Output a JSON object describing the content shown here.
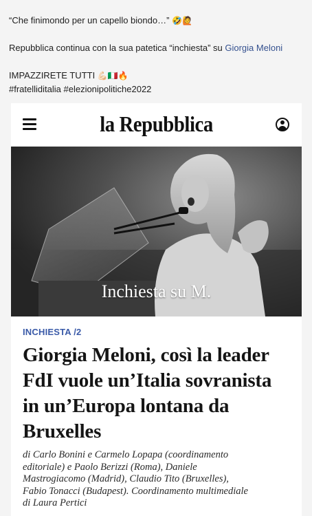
{
  "post": {
    "line1_text": "“Che finimondo per un capello biondo…”",
    "line1_emojis": "🤣🙋",
    "line2_prefix": "Repubblica continua con la sua patetica “inchiesta” su",
    "line2_mention": "Giorgia Meloni",
    "line3_text": "IMPAZZIRETE TUTTI",
    "line3_emojis": "💪🏻🇮🇹🔥",
    "hashtags": "#fratelliditalia #elezionipolitiche2022"
  },
  "article": {
    "masthead": "la Repubblica",
    "photo_caption": "Inchiesta su M.",
    "kicker": "INCHIESTA /2",
    "headline_lines": [
      "Giorgia Meloni, così la leader",
      "FdI vuole un’Italia sovranista",
      "in un’Europa lontana da",
      "Bruxelles"
    ],
    "byline_lines": [
      "di Carlo Bonini e Carmelo Lopapa (coordinamento",
      "editoriale) e Paolo Berizzi (Roma), Daniele",
      "Mastrogiacomo (Madrid), Claudio Tito (Bruxelles),",
      "Fabio Tonacci (Budapest). Coordinamento multimediale",
      "di Laura Pertici"
    ]
  },
  "icons": {
    "menu": "hamburger-menu-icon",
    "profile": "user-profile-icon"
  },
  "colors": {
    "kicker": "#3a5aa8",
    "mention": "#35518f",
    "background": "#f4f4f4"
  }
}
